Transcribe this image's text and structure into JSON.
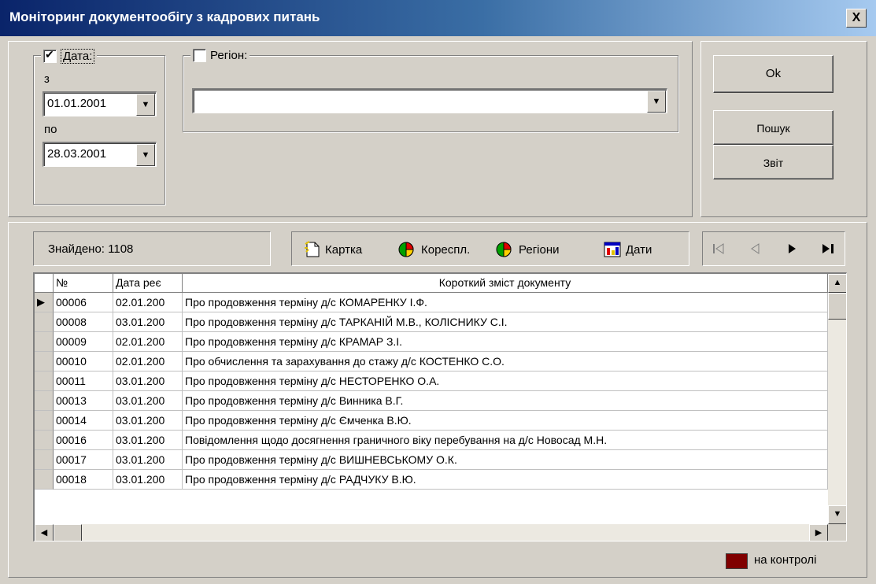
{
  "window": {
    "title": "Моніторинг документообігу з кадрових питань",
    "close_label": "X"
  },
  "filters": {
    "date_label": "Дата:",
    "date_checked": true,
    "from_label": "з",
    "from_value": "01.01.2001",
    "to_label": "по",
    "to_value": "28.03.2001",
    "region_label": "Регіон:",
    "region_checked": false,
    "region_value": ""
  },
  "buttons": {
    "ok": "Ok",
    "search": "Пошук",
    "report": "Звіт"
  },
  "found": {
    "text": "Знайдено: 1108"
  },
  "toolbar": {
    "card": "Картка",
    "corresp": "Кореспл.",
    "regions": "Регіони",
    "dates": "Дати"
  },
  "nav": {
    "first": "first",
    "prev": "prev",
    "next": "next",
    "last": "last"
  },
  "table": {
    "headers": [
      "№",
      "Дата реє",
      "Короткий зміст документу"
    ],
    "rows": [
      [
        "00006",
        "02.01.200",
        "Про продовження терміну д/с КОМАРЕНКУ І.Ф."
      ],
      [
        "00008",
        "03.01.200",
        "Про продовження терміну д/с ТАРКАНІЙ М.В., КОЛІСНИКУ С.І."
      ],
      [
        "00009",
        "02.01.200",
        "Про продовження терміну д/с КРАМАР З.І."
      ],
      [
        "00010",
        "02.01.200",
        "Про обчислення та зарахування до стажу д/с КОСТЕНКО С.О."
      ],
      [
        "00011",
        "03.01.200",
        "Про продовження терміну д/с НЕСТОРЕНКО О.А."
      ],
      [
        "00013",
        "03.01.200",
        "Про продовження терміну д/с Винника В.Г."
      ],
      [
        "00014",
        "03.01.200",
        "Про продовження терміну д/с Ємченка В.Ю."
      ],
      [
        "00016",
        "03.01.200",
        "Повідомлення щодо досягнення граничного віку перебування на д/с  Новосад М.Н."
      ],
      [
        "00017",
        "03.01.200",
        "Про продовження терміну д/с ВИШНЕВСЬКОМУ О.К."
      ],
      [
        "00018",
        "03.01.200",
        "Про продовження терміну д/с РАДЧУКУ В.Ю."
      ]
    ],
    "current_row": 0
  },
  "legend": {
    "label": "на контролі",
    "color": "#800000"
  }
}
